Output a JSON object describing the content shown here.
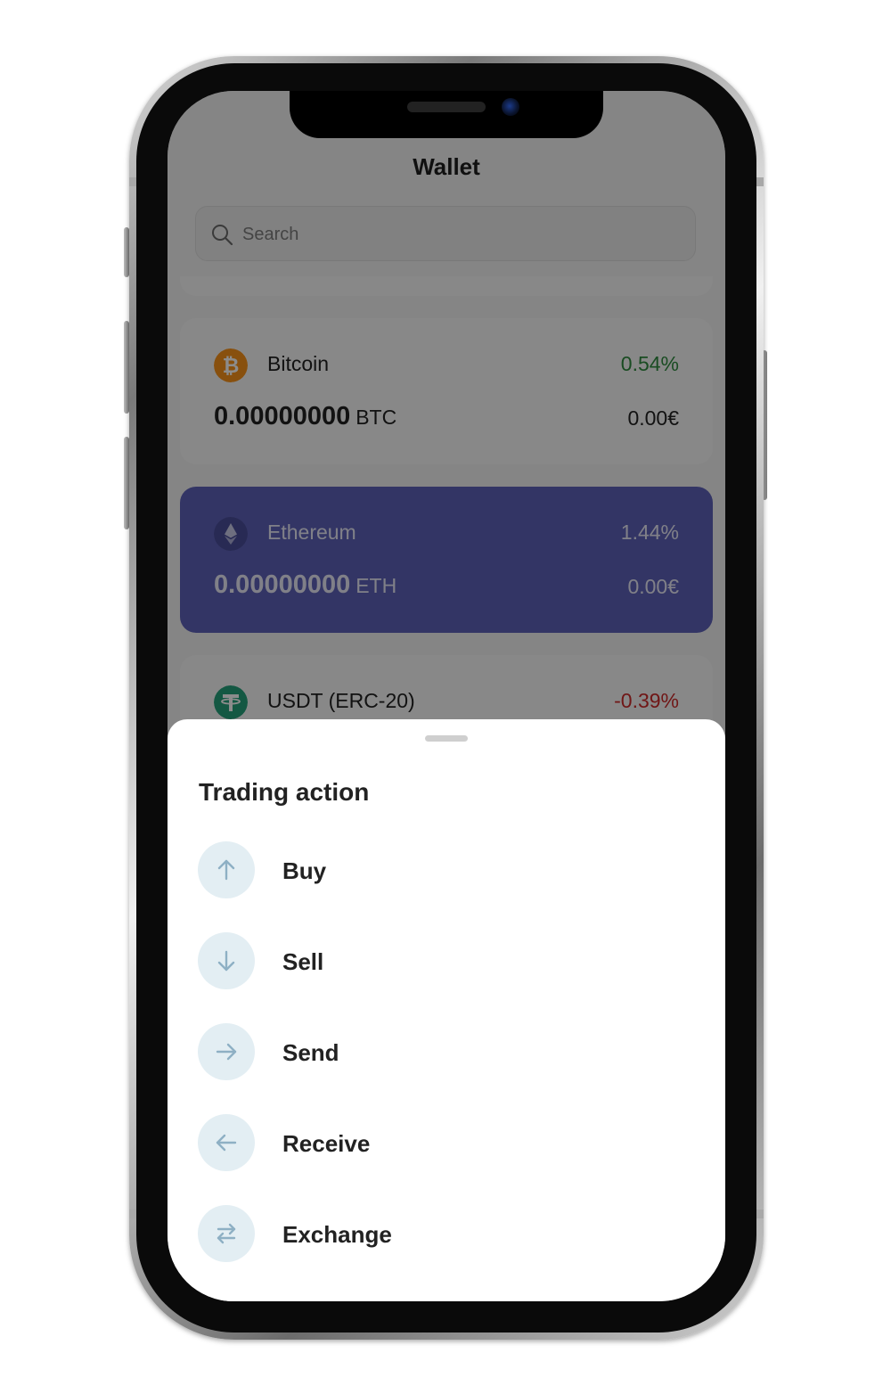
{
  "colors": {
    "overlay_tint": "#000000",
    "selected_card": "#5e62b8",
    "positive": "#2f8a3e",
    "negative": "#cc2a2a",
    "action_icon_bg": "#e3eef3",
    "action_icon_stroke": "#8eb0c4",
    "bitcoin_orange": "#f7931a",
    "tether_green": "#26a17b"
  },
  "header": {
    "title": "Wallet"
  },
  "search": {
    "placeholder": "Search",
    "icon": "search-icon"
  },
  "coins": [
    {
      "name": "Bitcoin",
      "change": "0.54%",
      "amount": "0.00000000",
      "unit": "BTC",
      "fiat": "0.00€",
      "icon": "bitcoin-icon",
      "selected": false
    },
    {
      "name": "Ethereum",
      "change": "1.44%",
      "amount": "0.00000000",
      "unit": "ETH",
      "fiat": "0.00€",
      "icon": "ethereum-icon",
      "selected": true
    },
    {
      "name": "USDT (ERC-20)",
      "change": "-0.39%",
      "icon": "tether-icon",
      "selected": false
    }
  ],
  "sheet": {
    "title": "Trading action",
    "actions": [
      {
        "label": "Buy",
        "icon": "arrow-up-icon"
      },
      {
        "label": "Sell",
        "icon": "arrow-down-icon"
      },
      {
        "label": "Send",
        "icon": "arrow-right-icon"
      },
      {
        "label": "Receive",
        "icon": "arrow-left-icon"
      },
      {
        "label": "Exchange",
        "icon": "exchange-icon"
      }
    ]
  }
}
